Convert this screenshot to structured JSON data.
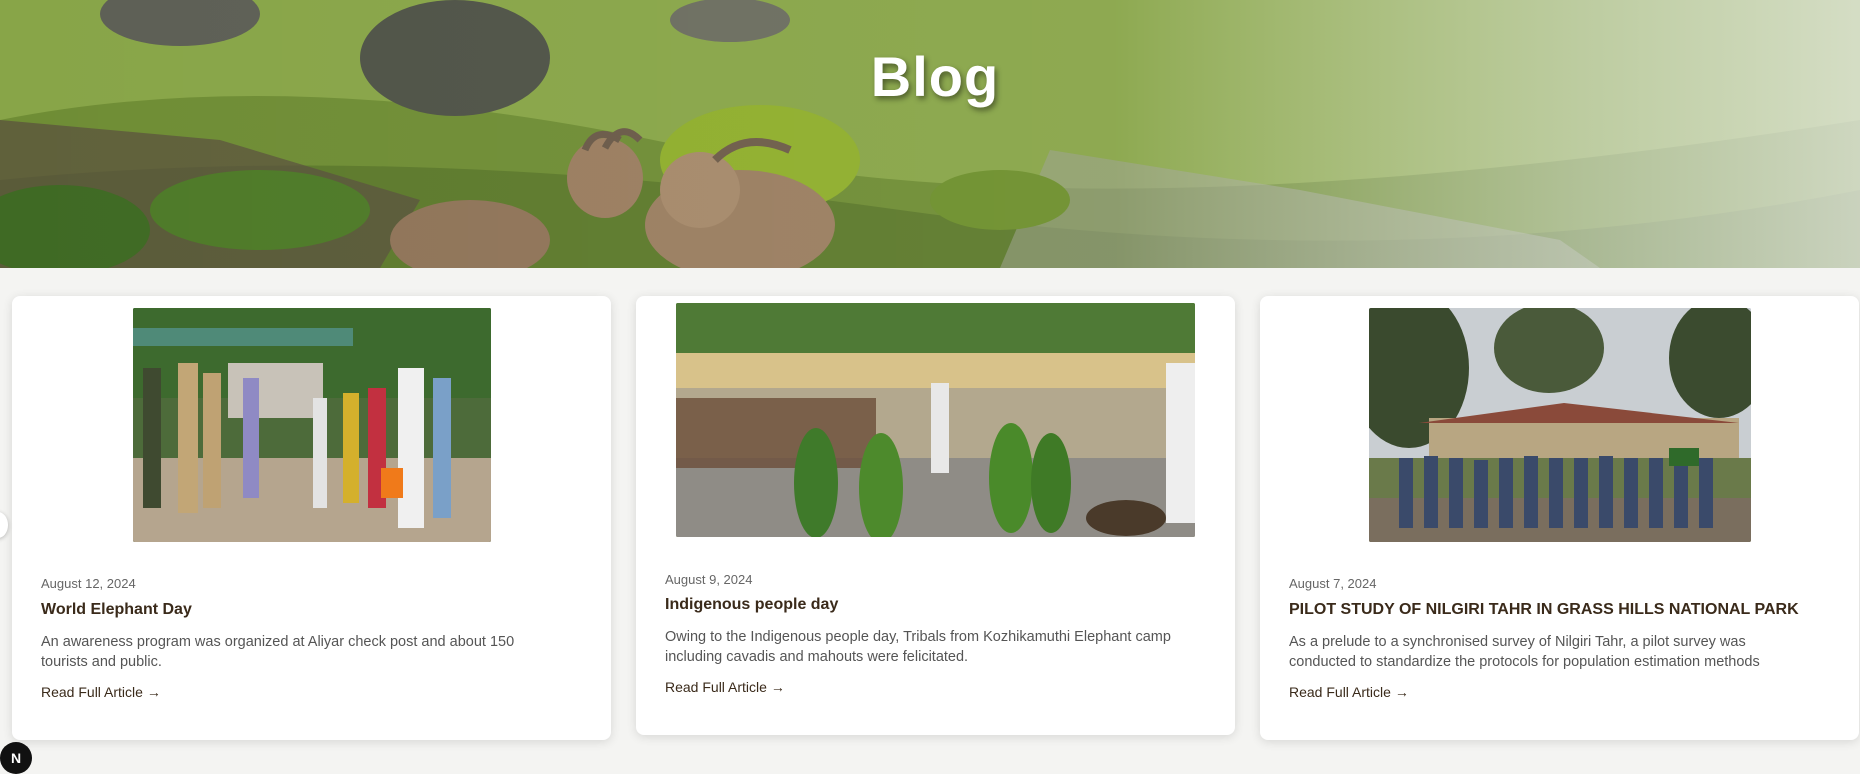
{
  "hero": {
    "title": "Blog"
  },
  "posts": [
    {
      "date": "August 12, 2024",
      "title": "World Elephant Day",
      "excerpt": "An awareness program was organized at Aliyar check post and about 150 tourists and public.",
      "link": "Read Full Article →",
      "image": "awareness-program-photo"
    },
    {
      "date": "August 9, 2024",
      "title": "Indigenous people day",
      "excerpt": "Owing to the Indigenous people day, Tribals from Kozhikamuthi Elephant camp including cavadis and mahouts were felicitated.",
      "link": "Read Full Article →",
      "image": "tribal-dance-photo"
    },
    {
      "date": "August 7, 2024",
      "title": "PILOT STUDY OF NILGIRI TAHR IN GRASS HILLS NATIONAL PARK",
      "excerpt": "As a prelude to a synchronised survey of Nilgiri Tahr, a pilot survey was conducted to standardize the protocols for population estimation methods",
      "link": "Read Full Article →",
      "image": "group-photo"
    }
  ],
  "badge": {
    "label": "N"
  },
  "colors": {
    "title_text": "#3a2a1a",
    "body_text": "#555555",
    "date_text": "#666666"
  }
}
